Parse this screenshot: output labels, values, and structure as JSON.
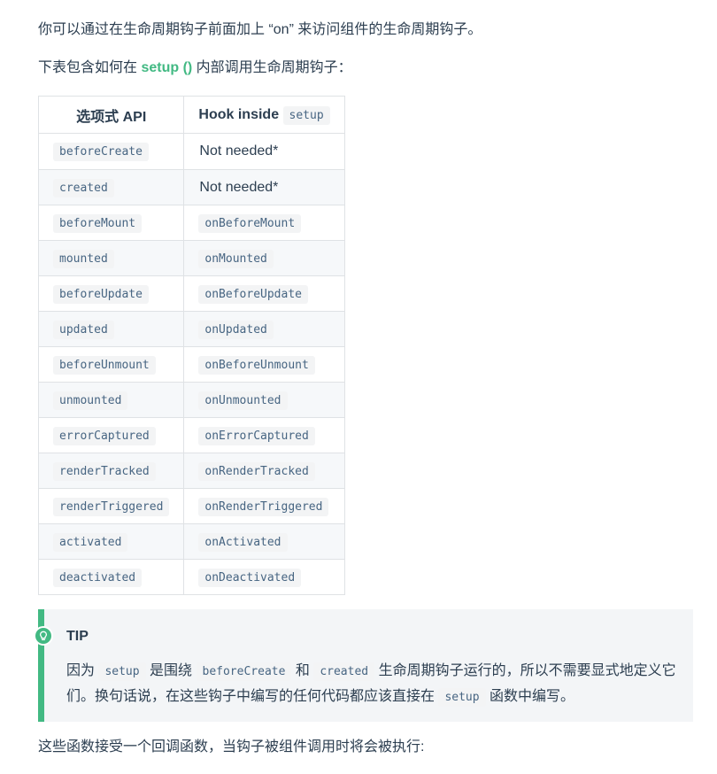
{
  "intro": {
    "line1": "你可以通过在生命周期钩子前面加上 “on” 来访问组件的生命周期钩子。",
    "line2_before": "下表包含如何在 ",
    "line2_link": "setup ()",
    "line2_after": " 内部调用生命周期钩子："
  },
  "table": {
    "header_col1": "选项式 API",
    "header_col2_text": "Hook inside ",
    "header_col2_code": "setup",
    "rows": [
      {
        "option": "beforeCreate",
        "hook": "Not needed*"
      },
      {
        "option": "created",
        "hook": "Not needed*"
      },
      {
        "option": "beforeMount",
        "hook": "onBeforeMount"
      },
      {
        "option": "mounted",
        "hook": "onMounted"
      },
      {
        "option": "beforeUpdate",
        "hook": "onBeforeUpdate"
      },
      {
        "option": "updated",
        "hook": "onUpdated"
      },
      {
        "option": "beforeUnmount",
        "hook": "onBeforeUnmount"
      },
      {
        "option": "unmounted",
        "hook": "onUnmounted"
      },
      {
        "option": "errorCaptured",
        "hook": "onErrorCaptured"
      },
      {
        "option": "renderTracked",
        "hook": "onRenderTracked"
      },
      {
        "option": "renderTriggered",
        "hook": "onRenderTriggered"
      },
      {
        "option": "activated",
        "hook": "onActivated"
      },
      {
        "option": "deactivated",
        "hook": "onDeactivated"
      }
    ]
  },
  "tip": {
    "icon": "lightbulb-icon",
    "title": "TIP",
    "t1": "因为 ",
    "c1": "setup",
    "t2": " 是围绕 ",
    "c2": "beforeCreate",
    "t3": " 和 ",
    "c3": "created",
    "t4": " 生命周期钩子运行的，所以不需要显式地定义它们。换句话说，在这些钩子中编写的任何代码都应该直接在 ",
    "c4": "setup",
    "t5": " 函数中编写。"
  },
  "outro": "这些函数接受一个回调函数，当钩子被组件调用时将会被执行:",
  "colors": {
    "accent": "#42b983",
    "text": "#2c3e50",
    "code_text": "#476582",
    "code_bg": "#f3f4f5",
    "tip_bg": "#f3f5f7"
  }
}
